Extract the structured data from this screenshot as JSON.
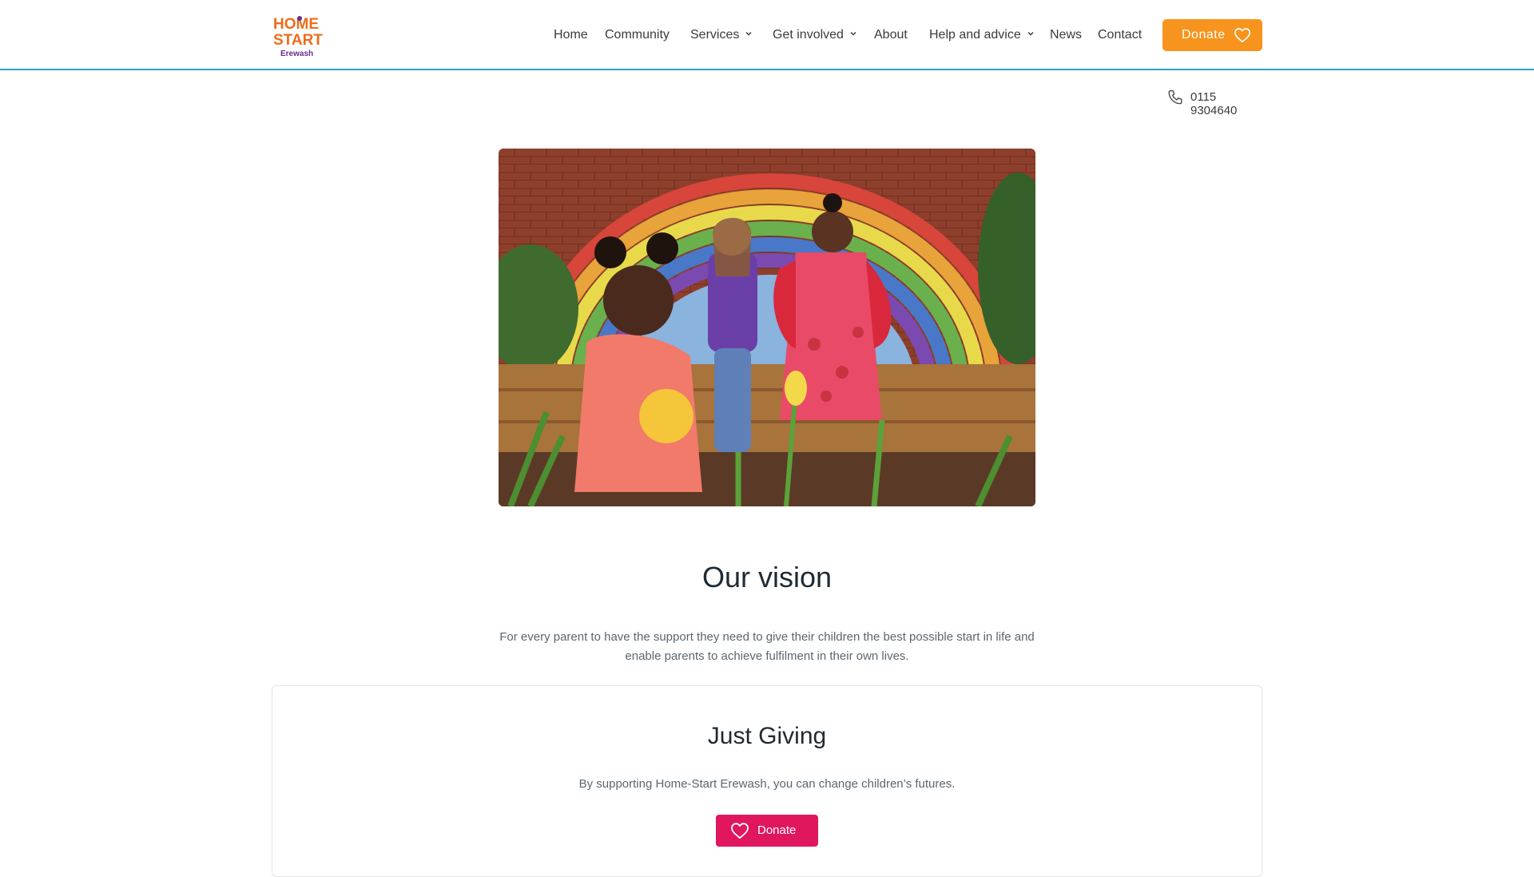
{
  "header": {
    "logo": {
      "line1": "HOME",
      "line2": "START",
      "line3": "Erewash"
    },
    "nav": [
      {
        "label": "Home",
        "dropdown": false
      },
      {
        "label": "Community",
        "dropdown": false
      },
      {
        "label": "Services",
        "dropdown": true
      },
      {
        "label": "Get involved",
        "dropdown": true
      },
      {
        "label": "About",
        "dropdown": false
      },
      {
        "label": "Help and advice",
        "dropdown": true
      },
      {
        "label": "News",
        "dropdown": false
      },
      {
        "label": "Contact",
        "dropdown": false
      }
    ],
    "donate_label": "Donate",
    "phone": "0115 9304640"
  },
  "vision": {
    "title": "Our vision",
    "text": "For every parent to have the support they need to give their children the best possible start in life and enable parents to achieve fulfilment in their own lives."
  },
  "just_giving": {
    "title": "Just Giving",
    "text": "By supporting Home-Start Erewash, you can change children’s futures.",
    "donate_label": "Donate"
  },
  "colors": {
    "accent_orange": "#f7941d",
    "accent_pink": "#e0165e",
    "header_border": "#2aa3c2"
  }
}
